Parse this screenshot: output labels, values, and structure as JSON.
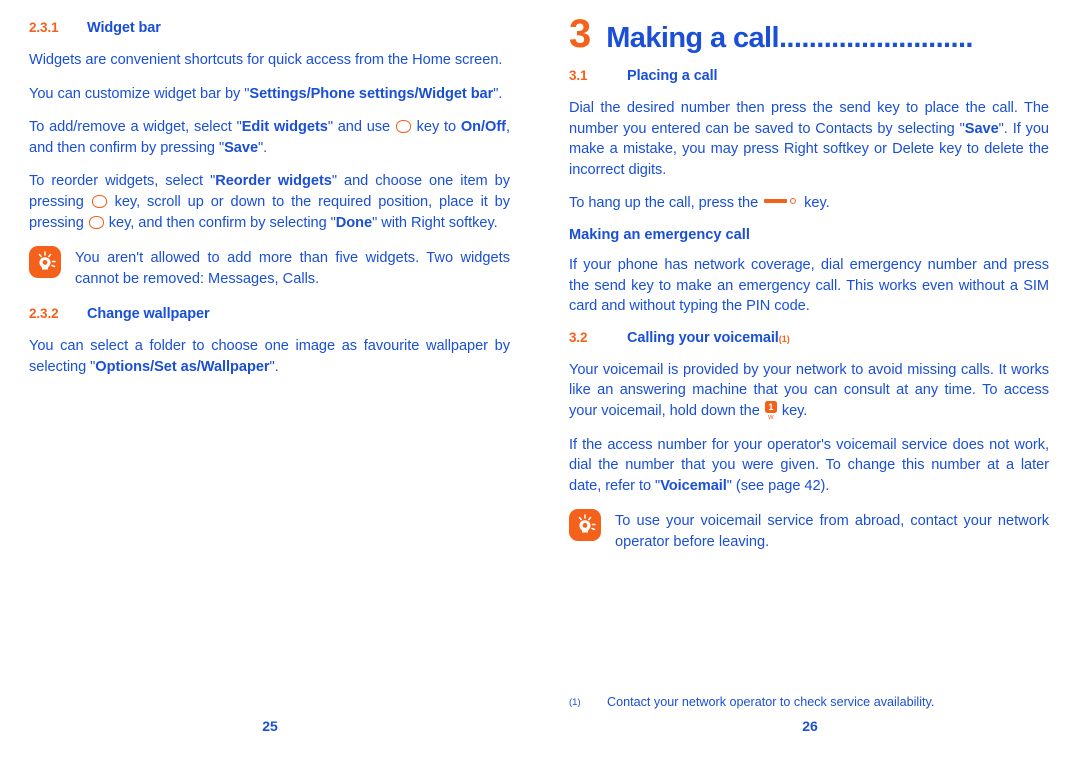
{
  "left_page": {
    "page_number": "25",
    "sections": [
      {
        "number": "2.3.1",
        "title": "Widget bar"
      },
      {
        "number": "2.3.2",
        "title": "Change wallpaper"
      }
    ],
    "paragraphs": {
      "p1": "Widgets are convenient shortcuts for quick access from the Home screen.",
      "p2_a": "You can customize widget bar by \"",
      "p2_b": "Settings/Phone settings/Widget bar",
      "p2_c": "\".",
      "p3_a": "To add/remove a widget, select \"",
      "p3_b": "Edit widgets",
      "p3_c": "\" and use ",
      "p3_d": " key to ",
      "p3_e": "On/Off",
      "p3_f": ", and then confirm by pressing \"",
      "p3_g": "Save",
      "p3_h": "\".",
      "p4_a": "To reorder widgets, select \"",
      "p4_b": "Reorder widgets",
      "p4_c": "\" and choose one item by pressing ",
      "p4_d": " key, scroll up or down to the required position, place it by pressing ",
      "p4_e": " key, and then confirm by selecting \"",
      "p4_f": "Done",
      "p4_g": "\" with Right softkey.",
      "p5_a": "You can select a folder to choose one image as favourite wallpaper by selecting \"",
      "p5_b": "Options/Set as/Wallpaper",
      "p5_c": "\"."
    },
    "note": {
      "icon": "lightbulb-tip-icon",
      "text": "You aren't allowed to add more than five widgets. Two widgets cannot be removed: Messages, Calls."
    }
  },
  "right_page": {
    "page_number": "26",
    "chapter": {
      "number": "3",
      "title": "Making a call",
      "leader": ".........................."
    },
    "sections": [
      {
        "number": "3.1",
        "title": "Placing a call"
      },
      {
        "number": "3.2",
        "title": "Calling your voicemail",
        "superscript": "(1)"
      }
    ],
    "subheading": "Making an emergency call",
    "paragraphs": {
      "p1_a": "Dial the desired number then press the send key to place the call. The number you entered can be saved to Contacts by selecting \"",
      "p1_b": "Save",
      "p1_c": "\". If you make a mistake, you may press Right softkey or Delete key to delete the incorrect digits.",
      "p2_a": "To hang up the call, press the ",
      "p2_b": " key.",
      "p3": "If your phone has network coverage, dial emergency number and press the send key to make an emergency call. This works even without a SIM card and without typing the PIN code.",
      "p4_a": "Your voicemail is provided by your network to avoid missing calls. It works like an answering machine that you can consult at any time. To access your voicemail, hold down the ",
      "p4_b": " key.",
      "p5_a": "If the access number for your operator's voicemail service does not work, dial the number that you were given. To change this number at a later date, refer to \"",
      "p5_b": "Voicemail",
      "p5_c": "\" (see page 42)."
    },
    "note": {
      "icon": "lightbulb-tip-icon",
      "text": "To use your voicemail service from abroad, contact your network operator before leaving."
    },
    "footnote": {
      "mark": "(1)",
      "text": "Contact your network operator to check service availability."
    },
    "voicemail_key": {
      "label": "1",
      "sub": "w"
    }
  },
  "colors": {
    "orange": "#f4611a",
    "blue": "#1a4fd6",
    "background": "#ffffff"
  }
}
